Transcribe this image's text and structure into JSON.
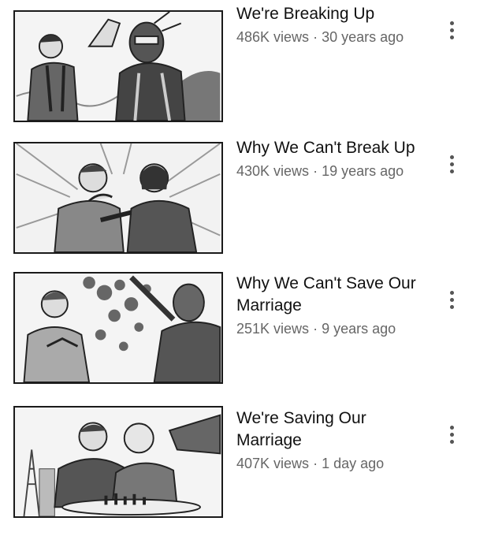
{
  "videos": [
    {
      "title": "We're Breaking Up",
      "views": "486K views",
      "separator": "·",
      "age": "30 years ago",
      "menu_icon": "more-vert-icon",
      "thumbnail": "sketch of a masked hero shoving a man away"
    },
    {
      "title": "Why We Can't Break Up",
      "views": "430K views",
      "separator": "·",
      "age": "19 years ago",
      "menu_icon": "more-vert-icon",
      "thumbnail": "sketch of two men, one clutching his chest"
    },
    {
      "title": "Why We Can't Save Our Marriage",
      "views": "251K views",
      "separator": "·",
      "age": "9 years ago",
      "menu_icon": "more-vert-icon",
      "thumbnail": "sketch of a man seated while a masked figure grieves"
    },
    {
      "title": "We're Saving Our Marriage",
      "views": "407K views",
      "separator": "·",
      "age": "1 day ago",
      "menu_icon": "more-vert-icon",
      "thumbnail": "sketch of two men kissing at a table with a chess set"
    }
  ]
}
